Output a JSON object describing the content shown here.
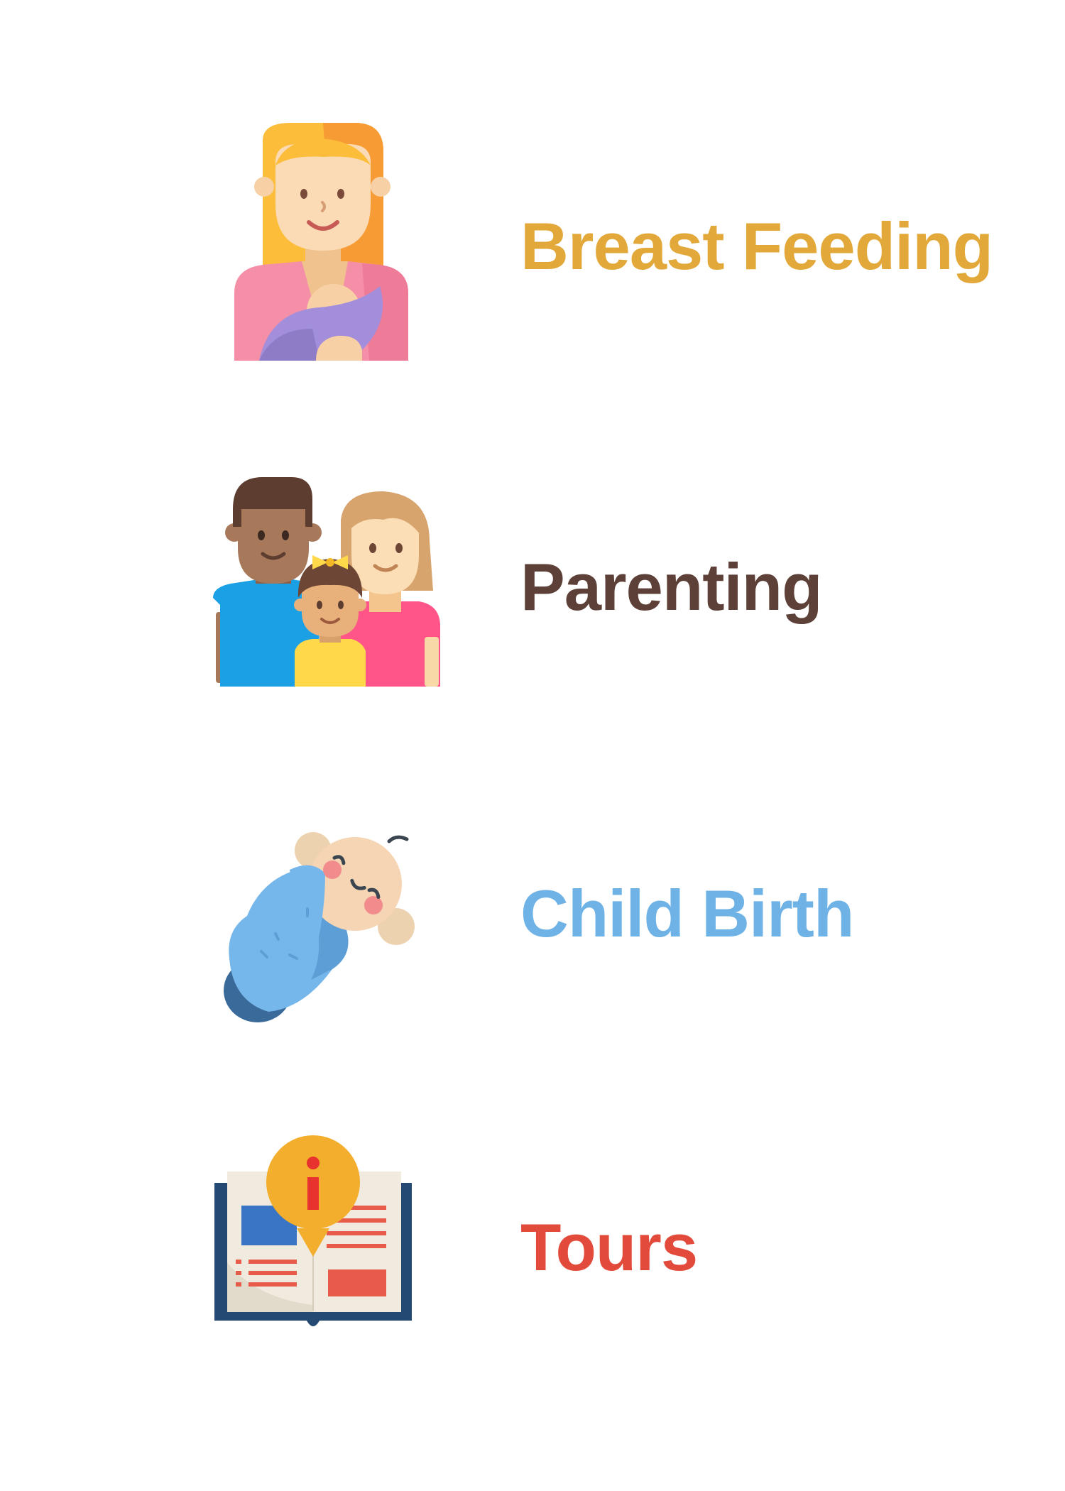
{
  "items": [
    {
      "label": "Breast Feeding",
      "color": "#E2A93A",
      "icon": "breastfeeding-mother-icon"
    },
    {
      "label": "Parenting",
      "color": "#5D4037",
      "icon": "family-icon"
    },
    {
      "label": "Child Birth",
      "color": "#6FB3E6",
      "icon": "swaddled-baby-icon"
    },
    {
      "label": "Tours",
      "color": "#E24B3B",
      "icon": "info-guidebook-icon"
    }
  ]
}
